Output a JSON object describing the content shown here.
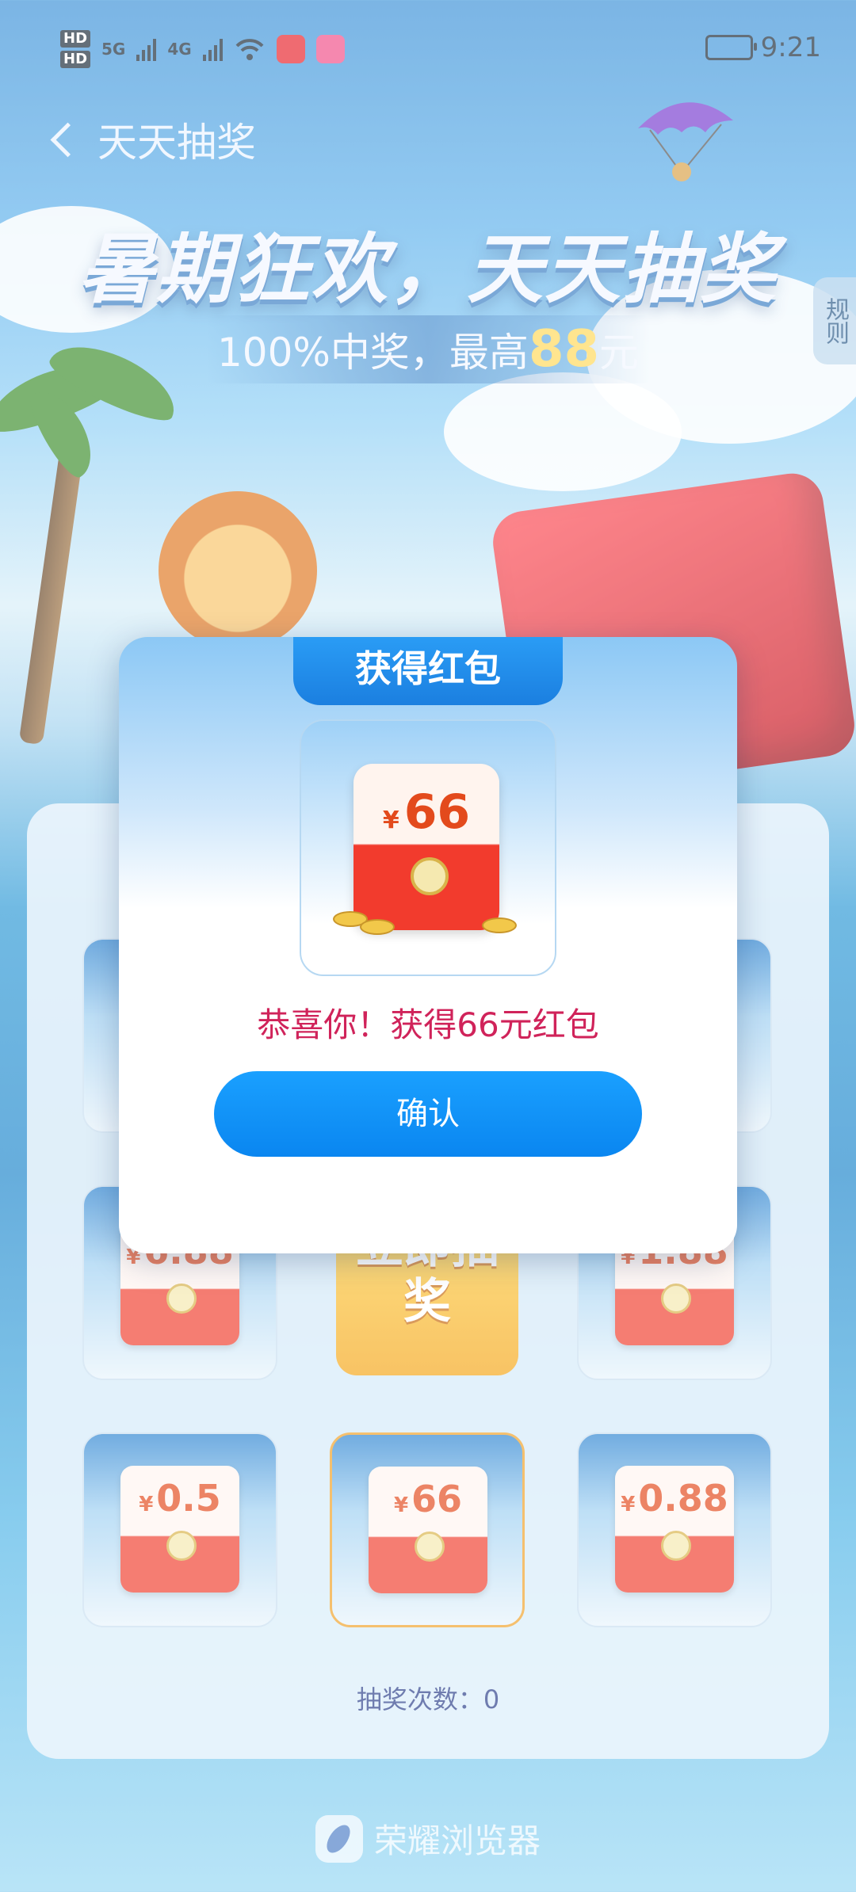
{
  "status_bar": {
    "hd1": "HD",
    "hd2": "HD",
    "net1": "5G",
    "net2": "4G",
    "time": "9:21"
  },
  "nav": {
    "title": "天天抽奖"
  },
  "banner": {
    "headline": "暑期狂欢，天天抽奖",
    "sub_prefix": "100%中奖，最高",
    "sub_highlight": "88",
    "sub_suffix": "元",
    "rules": "规则"
  },
  "grid": {
    "cells": [
      {
        "currency": "¥",
        "amount": "6.88"
      },
      {
        "currency": "¥",
        "amount": "1.88"
      },
      {
        "currency": "¥",
        "amount": "0.5"
      },
      {
        "currency": "¥",
        "amount": "66"
      },
      {
        "currency": "¥",
        "amount": "0.88"
      }
    ],
    "center_button": "立即抽奖",
    "draw_count_label": "抽奖次数：",
    "draw_count": "0"
  },
  "modal": {
    "title": "获得红包",
    "prize_currency": "¥",
    "prize_amount": "66",
    "message": "恭喜你！获得66元红包",
    "confirm": "确认"
  },
  "footer": {
    "brand": "荣耀浏览器"
  },
  "colors": {
    "accent": "#0a86f0",
    "message": "#d0235a",
    "envelope_red": "#f23b2d",
    "amount_orange": "#e34a1c"
  }
}
